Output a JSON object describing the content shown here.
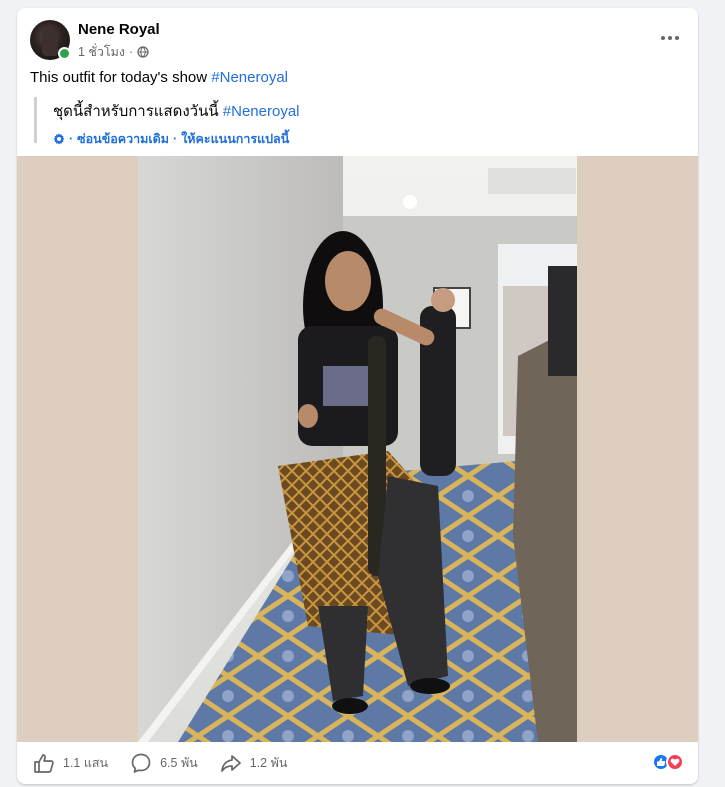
{
  "post": {
    "author": "Nene Royal",
    "time": "1 ชั่วโมง",
    "separator": "·",
    "text": "This outfit for today's show ",
    "hashtag": "#Neneroyal"
  },
  "translation": {
    "text": "ชุดนี้สำหรับการแสดงวันนี้ ",
    "hashtag": "#Neneroyal",
    "hide_original": "ซ่อนข้อความเดิม",
    "separator": "·",
    "rate": "ให้คะแนนการแปลนี้"
  },
  "actions": {
    "likes": "1.1 แสน",
    "comments": "6.5 พัน",
    "shares": "1.2 พัน"
  },
  "reactions": [
    "like-icon",
    "love-icon"
  ],
  "colors": {
    "link": "#216fdb",
    "secondary_text": "#65676b",
    "online": "#31a24c",
    "like": "#1877f2",
    "love": "#f33e58",
    "photo_backdrop": "#ddcebf"
  }
}
